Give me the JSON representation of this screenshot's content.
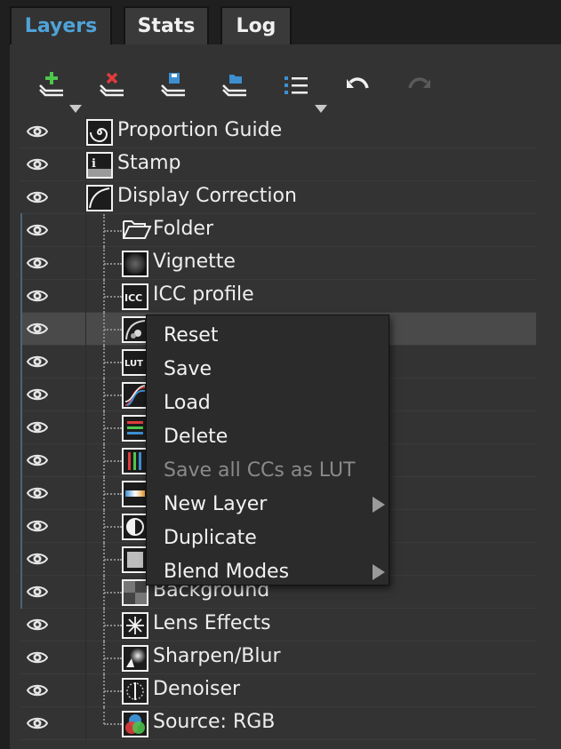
{
  "tabs": [
    {
      "label": "Layers",
      "active": true
    },
    {
      "label": "Stats",
      "active": false
    },
    {
      "label": "Log",
      "active": false
    }
  ],
  "toolbar": {
    "icons": [
      "add-layer-icon",
      "delete-layer-icon",
      "save-layer-icon",
      "load-layer-icon",
      "list-menu-icon",
      "undo-icon",
      "redo-icon"
    ],
    "redo_enabled": false
  },
  "colors": {
    "accent": "#4fa3d9",
    "panel": "#333333",
    "selected_row": "#4a4a4a",
    "menu": "#2b2b2b"
  },
  "layers": [
    {
      "label": "Proportion Guide",
      "icon": "spiral-icon",
      "level": 0
    },
    {
      "label": "Stamp",
      "icon": "stamp-icon",
      "level": 0
    },
    {
      "label": "Display Correction",
      "icon": "curve-icon",
      "level": 0
    },
    {
      "label": "Folder",
      "icon": "folder-icon",
      "level": 1
    },
    {
      "label": "Vignette",
      "icon": "vignette-icon",
      "level": 1
    },
    {
      "label": "ICC profile",
      "icon": "icc-icon",
      "level": 1,
      "icon_text": "ICC"
    },
    {
      "label": "",
      "icon": "color-correction-icon",
      "level": 1,
      "selected": true
    },
    {
      "label": "",
      "icon": "lut-icon",
      "level": 1,
      "icon_text": "LUT"
    },
    {
      "label": "",
      "icon": "curves-icon",
      "level": 1
    },
    {
      "label": "",
      "icon": "color-bars-icon",
      "level": 1
    },
    {
      "label": "",
      "icon": "levels-icon",
      "level": 1
    },
    {
      "label": "",
      "icon": "gradient-map-icon",
      "level": 1
    },
    {
      "label": "",
      "icon": "contrast-icon",
      "level": 1
    },
    {
      "label": "",
      "icon": "fill-icon",
      "level": 1
    },
    {
      "label": "Background",
      "icon": "checker-icon",
      "level": 1
    },
    {
      "label": "Lens Effects",
      "icon": "star-icon",
      "level": 1
    },
    {
      "label": "Sharpen/Blur",
      "icon": "sharpen-icon",
      "level": 1
    },
    {
      "label": "Denoiser",
      "icon": "denoiser-icon",
      "level": 1
    },
    {
      "label": "Source: RGB",
      "icon": "rgb-icon",
      "level": 1
    }
  ],
  "context_menu": {
    "items": [
      {
        "label": "Reset",
        "enabled": true,
        "submenu": false
      },
      {
        "label": "Save",
        "enabled": true,
        "submenu": false
      },
      {
        "label": "Load",
        "enabled": true,
        "submenu": false
      },
      {
        "label": "Delete",
        "enabled": true,
        "submenu": false
      },
      {
        "label": "Save all CCs as LUT",
        "enabled": false,
        "submenu": false
      },
      {
        "label": "New Layer",
        "enabled": true,
        "submenu": true
      },
      {
        "label": "Duplicate",
        "enabled": true,
        "submenu": false
      },
      {
        "label": "Blend Modes",
        "enabled": true,
        "submenu": true
      }
    ]
  }
}
